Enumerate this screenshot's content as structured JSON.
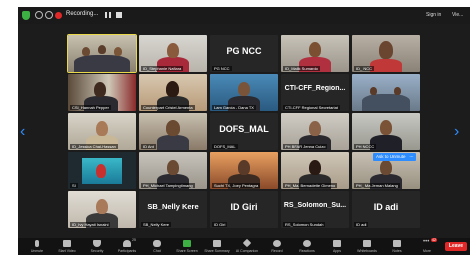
{
  "topbar": {
    "recording_label": "Recording...",
    "signin_label": "Sign in",
    "view_label": "Vie..."
  },
  "nav": {
    "prev": "‹",
    "next": "›"
  },
  "tiles": [
    {
      "caption": "",
      "active": true
    },
    {
      "caption": "ID_Stephanie Nafiara"
    },
    {
      "caption": "PG NCC",
      "big": "PG NCC"
    },
    {
      "caption": "ID_Malik Sumardo"
    },
    {
      "caption": "ID_ NCC"
    },
    {
      "caption": "CSI_Hannah Pepper"
    },
    {
      "caption": "Counterpart Cristel Armenta"
    },
    {
      "caption": "Lam Garcia - Dana TX"
    },
    {
      "caption": "CTI-CFF Regional Secretariat",
      "big": "CTI-CFF_Region..."
    },
    {
      "caption": ""
    },
    {
      "caption": "ID_Jessica Chai-Hassan"
    },
    {
      "caption": "ID Ant"
    },
    {
      "caption": "DOFS_MAL",
      "big": "DOFS_MAL"
    },
    {
      "caption": "PH BFAR Jenna Cuizo"
    },
    {
      "caption": "PH NCCC"
    },
    {
      "caption": "SI"
    },
    {
      "caption": "PH_Michael Tampingtimang"
    },
    {
      "caption": "Suchi TX, Joey Pentagra"
    },
    {
      "caption": "PH_Ma. Bernadette Gimeno"
    },
    {
      "caption": "PH_ Ma Jeman Malang"
    },
    {
      "caption": "ID_Ivy Hayati Isnaini"
    },
    {
      "caption": "SB_Nelly Kere",
      "big": "SB_Nelly Kere"
    },
    {
      "caption": "ID Giri",
      "big": "ID Giri"
    },
    {
      "caption": "RS_Solomon Sundah",
      "big": "RS_Solomon_Su..."
    },
    {
      "caption": "ID adi",
      "big": "ID adi"
    }
  ],
  "ask_unmute": {
    "label": "Ask to Unmute",
    "more": "..."
  },
  "toolbar": {
    "items": [
      {
        "label": "Unmute"
      },
      {
        "label": "Start Video"
      },
      {
        "label": "Security"
      },
      {
        "label": "Participants"
      },
      {
        "label": "Chat"
      },
      {
        "label": "Share Screen"
      },
      {
        "label": "Share Summary"
      },
      {
        "label": "AI Companion"
      },
      {
        "label": "Record"
      },
      {
        "label": "Reactions"
      },
      {
        "label": "Apps"
      },
      {
        "label": "Whiteboards"
      },
      {
        "label": "Notes"
      },
      {
        "label": "More"
      }
    ],
    "participants_count": "25",
    "more_badge": "42",
    "leave_label": "Leave"
  },
  "colors": {
    "accent": "#2d8cff",
    "leave": "#e02828",
    "active_border": "#e8d84a"
  }
}
